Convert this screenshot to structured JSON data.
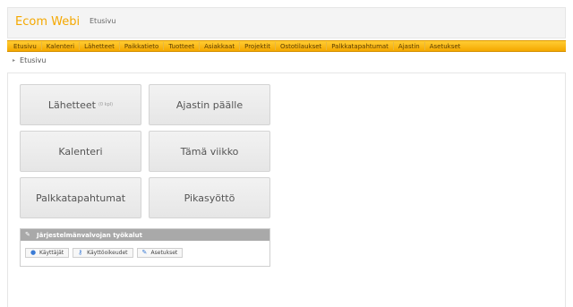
{
  "header": {
    "brand": "Ecom Webi",
    "crumb": "Etusivu"
  },
  "nav": [
    "Etusivu",
    "Kalenteri",
    "Lähetteet",
    "Paikkatieto",
    "Tuotteet",
    "Asiakkaat",
    "Projektit",
    "Ostotilaukset",
    "Palkkatapahtumat",
    "Ajastin",
    "Asetukset"
  ],
  "breadcrumb": {
    "item": "Etusivu"
  },
  "tiles": [
    {
      "label": "Lähetteet",
      "sub": "(0 kpl)"
    },
    {
      "label": "Ajastin päälle"
    },
    {
      "label": "Kalenteri"
    },
    {
      "label": "Tämä viikko"
    },
    {
      "label": "Palkkatapahtumat"
    },
    {
      "label": "Pikasyöttö"
    }
  ],
  "admin": {
    "title": "Järjestelmänvalvojan työkalut",
    "buttons": [
      "Käyttäjät",
      "Käyttöoikeudet",
      "Asetukset"
    ]
  },
  "colors": {
    "accent": "#f5a800",
    "brand": "#f5a800"
  },
  "icons": {
    "admin_title": "wrench-icon",
    "users": "user-icon",
    "rights": "key-icon",
    "settings": "wrench-icon"
  }
}
